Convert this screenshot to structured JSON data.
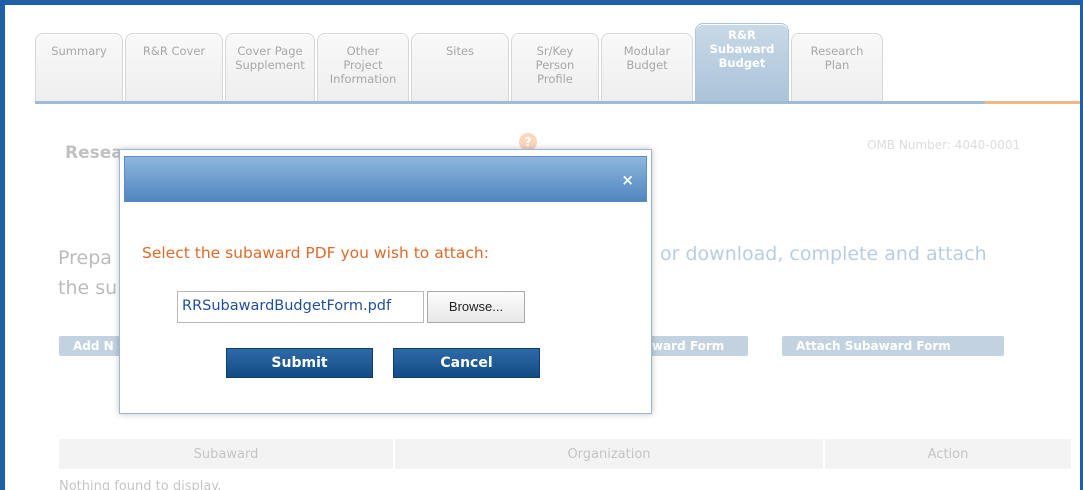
{
  "tabs": [
    {
      "label": "Summary",
      "active": false
    },
    {
      "label": "R&R Cover",
      "active": false
    },
    {
      "label": "Cover Page\nSupplement",
      "active": false
    },
    {
      "label": "Other\nProject\nInformation",
      "active": false
    },
    {
      "label": "Sites",
      "active": false
    },
    {
      "label": "Sr/Key\nPerson\nProfile",
      "active": false
    },
    {
      "label": "Modular\nBudget",
      "active": false
    },
    {
      "label": "R&R\nSubaward\nBudget",
      "active": true
    },
    {
      "label": "Research\nPlan",
      "active": false
    }
  ],
  "page": {
    "heading": "Resea",
    "omb": "OMB Number: 4040-0001",
    "instruction_left": "Prepa",
    "instruction_left_line2": "the su",
    "instruction_right": "or download, complete and attach",
    "buttons": {
      "add": "Add N",
      "download": "ward Form",
      "attach": "Attach Subaward Form"
    },
    "table": {
      "columns": [
        "Subaward",
        "Organization",
        "Action"
      ],
      "empty_text": "Nothing found to display."
    }
  },
  "modal": {
    "prompt": "Select the subaward PDF you wish to attach:",
    "file_value": "RRSubawardBudgetForm.pdf",
    "browse_label": "Browse...",
    "submit_label": "Submit",
    "cancel_label": "Cancel",
    "close_label": "×"
  },
  "colors": {
    "accent": "#1f5fa8",
    "prompt": "#e06a2a",
    "modal_header": "#4f86c0",
    "button": "#1a5a96"
  }
}
